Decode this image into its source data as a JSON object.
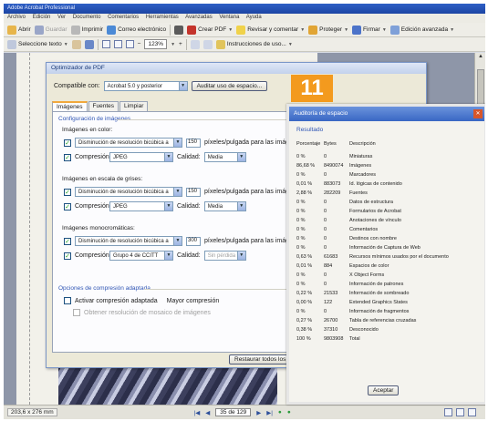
{
  "window": {
    "title": "Adobe Acrobat Professional",
    "menu": [
      "Archivo",
      "Edición",
      "Ver",
      "Documento",
      "Comentarios",
      "Herramientas",
      "Avanzadas",
      "Ventana",
      "Ayuda"
    ]
  },
  "toolbar1": {
    "abrir": "Abrir",
    "guardar": "Guardar",
    "imprimir": "Imprimir",
    "correo": "Correo electrónico",
    "crear_pdf": "Crear PDF",
    "revisar": "Revisar y comentar",
    "proteger": "Proteger",
    "firmar": "Firmar",
    "edicion": "Edición avanzada"
  },
  "toolbar2": {
    "seleccionar": "Seleccione texto",
    "zoom": "123%",
    "instrucciones": "Instrucciones de uso..."
  },
  "optimizer": {
    "title": "Optimizador de PDF",
    "compat_label": "Compatible con:",
    "compat_value": "Acrobat 5.0 y posterior",
    "audit_button": "Auditar uso de espacio...",
    "tabs": [
      "Imágenes",
      "Fuentes",
      "Limpiar"
    ],
    "config_title": "Configuración de imágenes",
    "color_title": "Imágenes en color:",
    "color_method": "Disminución de resolución bicúbica a",
    "color_ppi": "150",
    "color_suffix": "píxeles/pulgada para las imágenes",
    "gray_title": "Imágenes en escala de grises:",
    "gray_method": "Disminución de resolución bicúbica a",
    "gray_ppi": "150",
    "gray_suffix": "píxeles/pulgada para las imágenes",
    "mono_title": "Imágenes monocromáticas:",
    "mono_method": "Disminución de resolución bicúbica a",
    "mono_ppi": "300",
    "mono_suffix": "píxeles/pulgada para las imágenes",
    "compression_label": "Compresión:",
    "quality_label": "Calidad:",
    "color_compression": "JPEG",
    "color_quality": "Media",
    "gray_compression": "JPEG",
    "gray_quality": "Media",
    "mono_compression": "Grupo 4 de CCITT",
    "mono_quality": "Sin pérdida",
    "adaptive_title": "Opciones de compresión adaptada",
    "adaptive_check": "Activar compresión adaptada",
    "adaptive_slider_label": "Mayor compresión",
    "adaptive_sub": "Obtener resolución de mosaico de imágenes",
    "restore_button": "Restaurar todos los valores"
  },
  "badge": "11",
  "audit": {
    "title": "Auditoría de espacio",
    "section": "Resultado",
    "headers": [
      "Porcentaje",
      "Bytes",
      "Descripción"
    ],
    "rows": [
      [
        "0 %",
        "0",
        "Miniaturas"
      ],
      [
        "86,68 %",
        "8490074",
        "Imágenes"
      ],
      [
        "0 %",
        "0",
        "Marcadores"
      ],
      [
        "0,01 %",
        "883073",
        "Id. lógicas de contenido"
      ],
      [
        "2,88 %",
        "282209",
        "Fuentes"
      ],
      [
        "0 %",
        "0",
        "Datos de estructura"
      ],
      [
        "0 %",
        "0",
        "Formularios de Acrobat"
      ],
      [
        "0 %",
        "0",
        "Anotaciones de vínculo"
      ],
      [
        "0 %",
        "0",
        "Comentarios"
      ],
      [
        "0 %",
        "0",
        "Destinos con nombre"
      ],
      [
        "0 %",
        "0",
        "Información de Captura de Web"
      ],
      [
        "0,63 %",
        "61683",
        "Recursos mínimos usados por el documento"
      ],
      [
        "0,01 %",
        "884",
        "Espacios de color"
      ],
      [
        "0 %",
        "0",
        "X Object Forms"
      ],
      [
        "0 %",
        "0",
        "Información de patrones"
      ],
      [
        "0,22 %",
        "21533",
        "Información de sombreado"
      ],
      [
        "0,00 %",
        "122",
        "Extended Graphics States"
      ],
      [
        "0 %",
        "0",
        "Información de fragmentos"
      ],
      [
        "0,27 %",
        "26700",
        "Tabla de referencias cruzadas"
      ],
      [
        "0,38 %",
        "37310",
        "Desconocido"
      ],
      [
        "100 %",
        "9803908",
        "Total"
      ]
    ],
    "accept": "Aceptar"
  },
  "status": {
    "page_size": "203,6 x 276 mm",
    "page": "35 de 129"
  },
  "colors": {
    "badge": "#f39a1e",
    "titlebar": "#2e5fc6",
    "group_heading": "#2f55b4"
  }
}
